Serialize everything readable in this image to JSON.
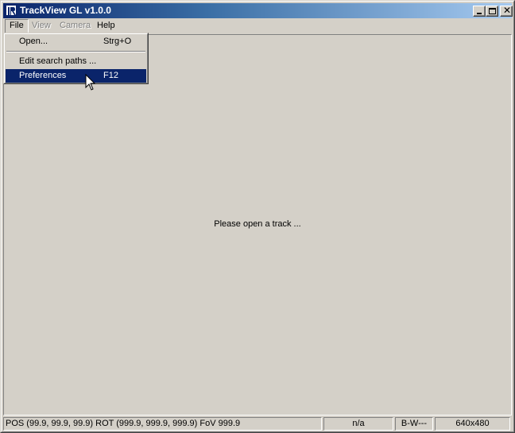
{
  "window": {
    "title": "TrackView GL v1.0.0",
    "icon": "app-logo-icon",
    "controls": {
      "minimize_icon": "minimize-icon",
      "maximize_icon": "maximize-icon",
      "close_glyph": "✕"
    }
  },
  "menubar": {
    "items": [
      {
        "label": "File",
        "enabled": true,
        "active": true
      },
      {
        "label": "View",
        "enabled": false
      },
      {
        "label": "Camera",
        "enabled": false
      },
      {
        "label": "Help",
        "enabled": true
      }
    ]
  },
  "file_menu": {
    "items": [
      {
        "label": "Open...",
        "shortcut": "Strg+O"
      },
      {
        "label": "Edit search paths ...",
        "shortcut": ""
      },
      {
        "label": "Preferences",
        "shortcut": "F12",
        "highlighted": true
      }
    ]
  },
  "main": {
    "placeholder": "Please open a track ..."
  },
  "statusbar": {
    "position": "POS (99.9, 99.9, 99.9) ROT (999.9, 999.9, 999.9) FoV 999.9",
    "field2": "n/a",
    "field3": "B-W---",
    "resolution": "640x480"
  },
  "colors": {
    "face": "#d4d0c8",
    "title_start": "#0a246a",
    "title_end": "#a6caf0",
    "highlight": "#0a246a"
  }
}
